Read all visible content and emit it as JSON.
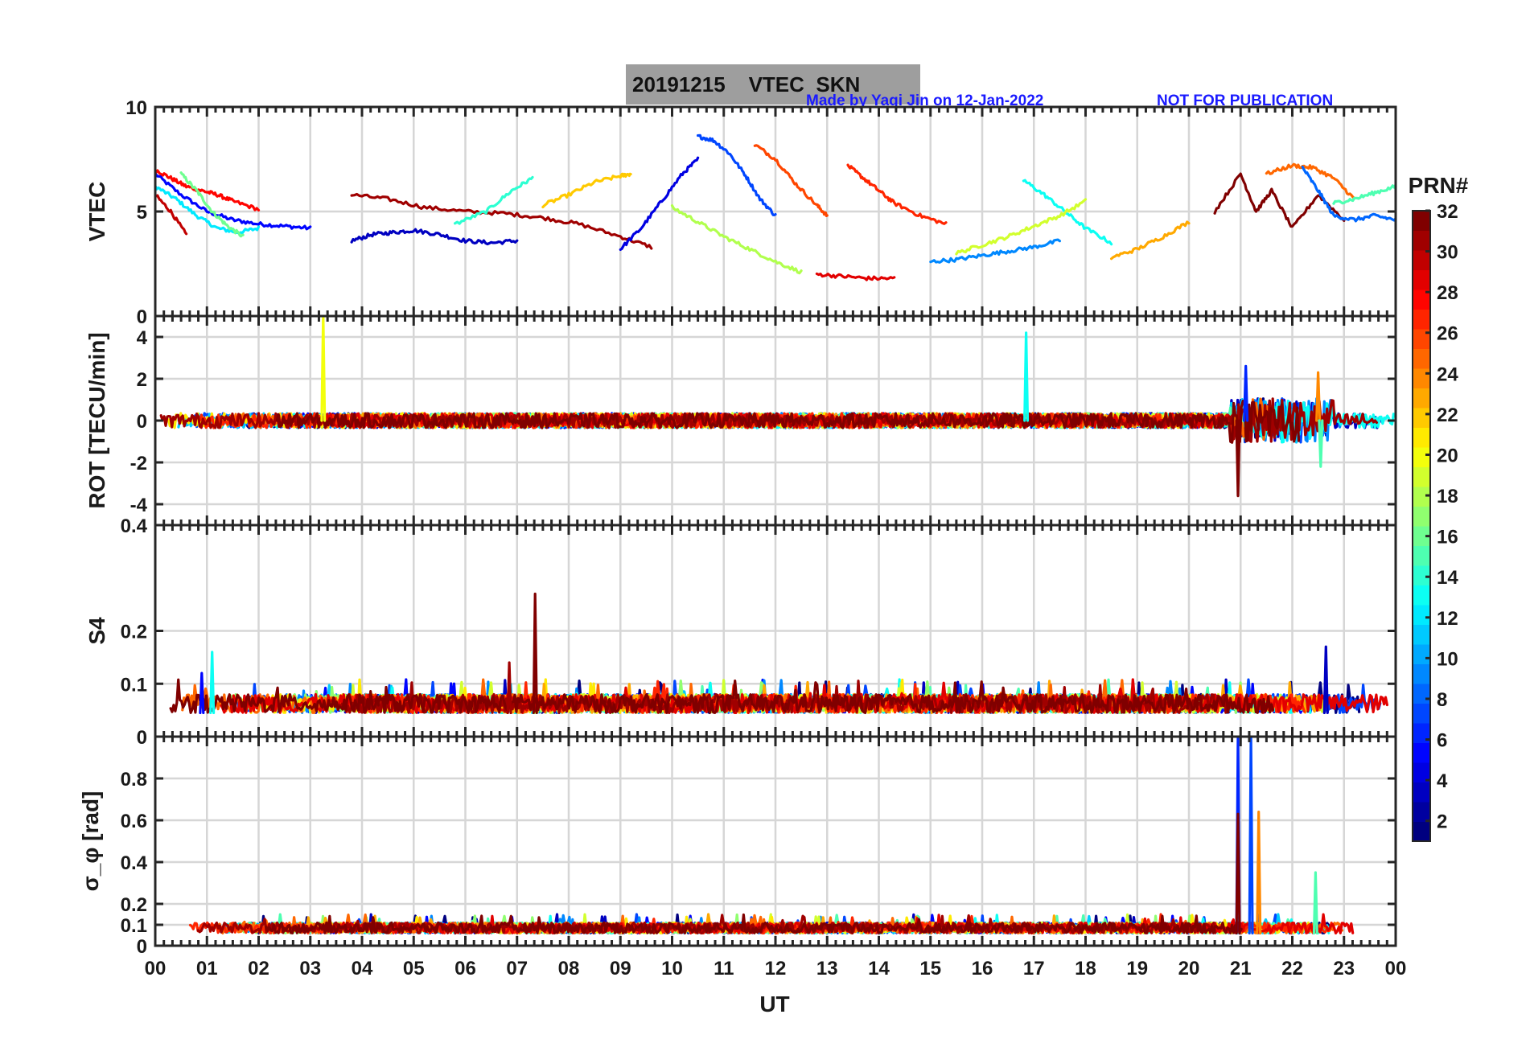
{
  "figure": {
    "title": "20191215    VTEC  SKN",
    "credit": "Made by Yaqi Jin on 12-Jan-2022",
    "notice": "NOT FOR PUBLICATION",
    "x_label": "UT",
    "x_tick_labels": [
      "00",
      "01",
      "02",
      "03",
      "04",
      "05",
      "06",
      "07",
      "08",
      "09",
      "10",
      "11",
      "12",
      "13",
      "14",
      "15",
      "16",
      "17",
      "18",
      "19",
      "20",
      "21",
      "22",
      "23",
      "00"
    ],
    "colorbar": {
      "title": "PRN#",
      "range": [
        1,
        32
      ],
      "tick_labels": [
        "2",
        "4",
        "6",
        "8",
        "10",
        "12",
        "14",
        "16",
        "18",
        "20",
        "22",
        "24",
        "26",
        "28",
        "30",
        "32"
      ],
      "colormap": "jet"
    }
  },
  "chart_data": [
    {
      "type": "line",
      "panel": "vtec",
      "ylabel": "VTEC",
      "xlim": [
        0,
        24
      ],
      "ylim": [
        0,
        10
      ],
      "yticks": [
        0,
        5,
        10
      ],
      "ytick_labels": [
        "0",
        "5",
        "10"
      ],
      "grid": true,
      "series_note": "one trace per satellite PRN 1-32, colored by PRN",
      "series": [
        {
          "prn": 5,
          "x": [
            0,
            0.5,
            1.0,
            1.5,
            2.0,
            2.5,
            3.0
          ],
          "y": [
            6.8,
            5.8,
            5.0,
            4.6,
            4.4,
            4.3,
            4.2
          ]
        },
        {
          "prn": 12,
          "x": [
            0,
            0.4,
            0.8,
            1.2,
            1.6,
            2.0
          ],
          "y": [
            6.2,
            5.6,
            4.8,
            4.2,
            4.0,
            4.2
          ]
        },
        {
          "prn": 28,
          "x": [
            0,
            0.3,
            0.6,
            0.9,
            1.2,
            1.5,
            2.0
          ],
          "y": [
            7.0,
            6.6,
            6.2,
            6.0,
            5.8,
            5.5,
            5.1
          ]
        },
        {
          "prn": 16,
          "x": [
            0.5,
            0.8,
            1.1,
            1.4,
            1.7
          ],
          "y": [
            6.8,
            6.0,
            5.0,
            4.3,
            3.8
          ]
        },
        {
          "prn": 30,
          "x": [
            0,
            0.3,
            0.6
          ],
          "y": [
            5.8,
            5.0,
            3.9
          ]
        },
        {
          "prn": 3,
          "x": [
            3.8,
            4.2,
            4.6,
            5.0,
            5.5,
            6.0,
            6.5,
            7.0
          ],
          "y": [
            3.6,
            3.9,
            4.0,
            4.1,
            3.9,
            3.6,
            3.5,
            3.6
          ]
        },
        {
          "prn": 31,
          "x": [
            3.8,
            4.5,
            5.2,
            6.0,
            6.8,
            7.5,
            8.2,
            9.0,
            9.6
          ],
          "y": [
            5.8,
            5.6,
            5.2,
            5.0,
            4.9,
            4.7,
            4.4,
            3.8,
            3.3
          ]
        },
        {
          "prn": 14,
          "x": [
            5.8,
            6.4,
            6.9,
            7.3
          ],
          "y": [
            4.4,
            5.0,
            6.0,
            6.6
          ]
        },
        {
          "prn": 22,
          "x": [
            7.5,
            8.0,
            8.5,
            9.0,
            9.2
          ],
          "y": [
            5.3,
            5.8,
            6.4,
            6.7,
            6.8
          ]
        },
        {
          "prn": 4,
          "x": [
            9.0,
            9.4,
            9.8,
            10.2,
            10.5
          ],
          "y": [
            3.2,
            4.2,
            5.5,
            6.8,
            7.5
          ]
        },
        {
          "prn": 7,
          "x": [
            10.5,
            10.8,
            11.1,
            11.4,
            11.7,
            12.0
          ],
          "y": [
            8.6,
            8.4,
            7.8,
            6.8,
            5.6,
            4.8
          ]
        },
        {
          "prn": 26,
          "x": [
            11.6,
            12.0,
            12.4,
            12.8,
            13.0
          ],
          "y": [
            8.2,
            7.5,
            6.3,
            5.3,
            4.8
          ]
        },
        {
          "prn": 18,
          "x": [
            10.0,
            10.5,
            11.0,
            11.5,
            12.0,
            12.5
          ],
          "y": [
            5.2,
            4.5,
            3.8,
            3.2,
            2.6,
            2.1
          ]
        },
        {
          "prn": 27,
          "x": [
            13.4,
            13.7,
            14.0,
            14.3,
            14.8,
            15.3
          ],
          "y": [
            7.2,
            6.6,
            6.0,
            5.4,
            4.8,
            4.4
          ]
        },
        {
          "prn": 29,
          "x": [
            12.8,
            13.3,
            13.8,
            14.3
          ],
          "y": [
            2.0,
            1.9,
            1.8,
            1.8
          ]
        },
        {
          "prn": 9,
          "x": [
            15.0,
            15.5,
            16.0,
            16.5,
            17.0,
            17.5
          ],
          "y": [
            2.6,
            2.7,
            2.9,
            3.1,
            3.3,
            3.6
          ]
        },
        {
          "prn": 13,
          "x": [
            16.8,
            17.2,
            17.6,
            18.0,
            18.5
          ],
          "y": [
            6.5,
            5.8,
            5.0,
            4.2,
            3.5
          ]
        },
        {
          "prn": 19,
          "x": [
            15.5,
            16.0,
            16.5,
            17.0,
            17.5,
            18.0
          ],
          "y": [
            3.0,
            3.4,
            3.8,
            4.3,
            4.8,
            5.5
          ]
        },
        {
          "prn": 23,
          "x": [
            18.5,
            19.0,
            19.5,
            20.0
          ],
          "y": [
            2.8,
            3.2,
            3.8,
            4.5
          ]
        },
        {
          "prn": 32,
          "x": [
            20.5,
            21.0,
            21.3,
            21.6,
            22.0,
            22.5,
            23.0
          ],
          "y": [
            5.0,
            6.8,
            5.0,
            6.0,
            4.2,
            5.8,
            4.6
          ]
        },
        {
          "prn": 25,
          "x": [
            21.5,
            22.0,
            22.4,
            22.8,
            23.2
          ],
          "y": [
            6.8,
            7.2,
            7.1,
            6.6,
            5.6
          ]
        },
        {
          "prn": 8,
          "x": [
            22.2,
            22.5,
            22.8,
            23.2,
            23.6,
            24.0
          ],
          "y": [
            7.1,
            6.0,
            4.8,
            4.6,
            4.8,
            4.6
          ]
        },
        {
          "prn": 15,
          "x": [
            22.8,
            23.2,
            23.6,
            24.0
          ],
          "y": [
            5.4,
            5.6,
            5.9,
            6.2
          ]
        }
      ]
    },
    {
      "type": "line",
      "panel": "rot",
      "ylabel": "ROT [TECU/min]",
      "xlim": [
        0,
        24
      ],
      "ylim": [
        -5,
        5
      ],
      "yticks": [
        -4,
        -2,
        0,
        2,
        4
      ],
      "ytick_labels": [
        "-4",
        "-2",
        "0",
        "2",
        "4"
      ],
      "grid": true,
      "series_note": "values scatter near 0 for all PRNs; notable spikes listed",
      "spikes": [
        {
          "prn": 20,
          "x": 3.25,
          "y": 5.0
        },
        {
          "prn": 13,
          "x": 16.85,
          "y": 4.2
        },
        {
          "prn": 32,
          "x": 20.95,
          "y": -3.6
        },
        {
          "prn": 6,
          "x": 21.1,
          "y": 2.6
        },
        {
          "prn": 24,
          "x": 22.5,
          "y": 2.3
        },
        {
          "prn": 15,
          "x": 22.55,
          "y": -2.2
        }
      ]
    },
    {
      "type": "line",
      "panel": "s4",
      "ylabel": "S4",
      "xlim": [
        0,
        24
      ],
      "ylim": [
        0,
        0.4
      ],
      "yticks": [
        0,
        0.1,
        0.2,
        0.4
      ],
      "ytick_labels": [
        "0",
        "0.1",
        "0.2",
        "0.4"
      ],
      "grid": true,
      "series_note": "baseline near 0.03-0.07 for all PRNs; notable spikes listed",
      "spikes": [
        {
          "prn": 13,
          "x": 1.1,
          "y": 0.16
        },
        {
          "prn": 31,
          "x": 6.85,
          "y": 0.14
        },
        {
          "prn": 32,
          "x": 7.35,
          "y": 0.27
        },
        {
          "prn": 5,
          "x": 0.9,
          "y": 0.12
        },
        {
          "prn": 3,
          "x": 22.65,
          "y": 0.17
        }
      ]
    },
    {
      "type": "line",
      "panel": "sigma_phi",
      "ylabel": "σ_φ [rad]",
      "xlim": [
        0,
        24
      ],
      "ylim": [
        0,
        1.0
      ],
      "yticks": [
        0,
        0.1,
        0.2,
        0.4,
        0.6,
        0.8
      ],
      "ytick_labels": [
        "0",
        "0.1",
        "0.2",
        "0.4",
        "0.6",
        "0.8"
      ],
      "grid": true,
      "series_note": "baseline near 0.04-0.12 for all PRNs; notable spikes listed",
      "spikes": [
        {
          "prn": 6,
          "x": 20.95,
          "y": 1.0
        },
        {
          "prn": 32,
          "x": 20.95,
          "y": 0.63
        },
        {
          "prn": 7,
          "x": 21.2,
          "y": 1.0
        },
        {
          "prn": 24,
          "x": 21.35,
          "y": 0.64
        },
        {
          "prn": 15,
          "x": 22.45,
          "y": 0.35
        }
      ]
    }
  ]
}
